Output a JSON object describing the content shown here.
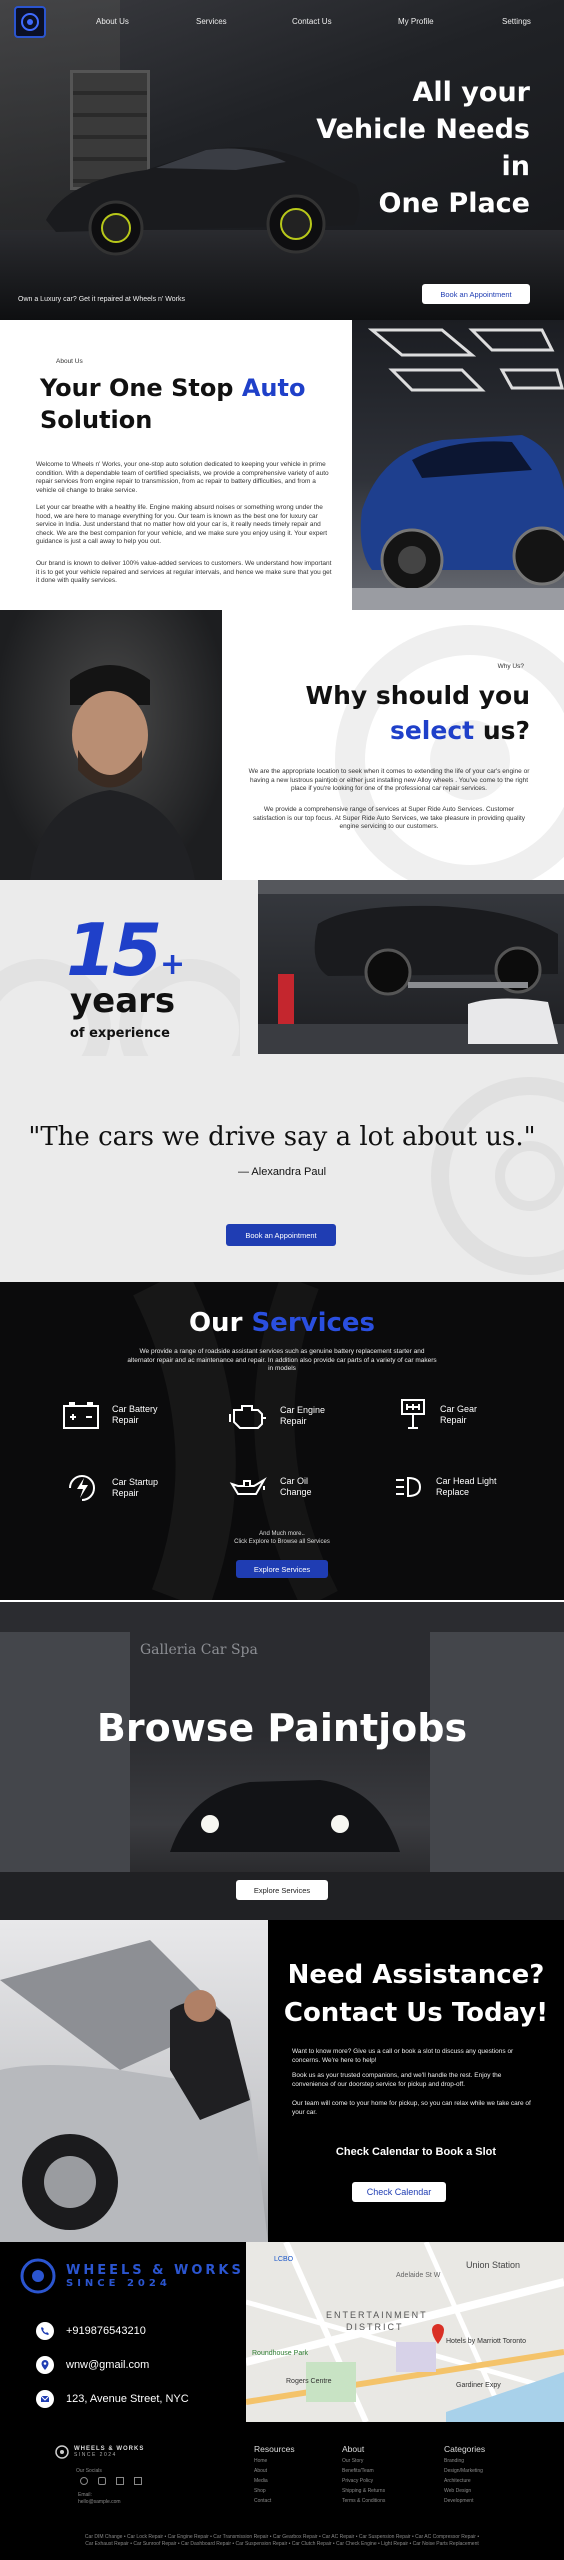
{
  "nav": {
    "logo_text": "W&W",
    "links": [
      "About Us",
      "Services",
      "Contact Us",
      "My Profile",
      "Settings"
    ]
  },
  "hero": {
    "heading_lines": [
      "All your",
      "Vehicle Needs",
      "in",
      "One Place"
    ],
    "tagline": "Own a Luxury car? Get it repaired at Wheels n' Works",
    "cta": "Book an Appointment"
  },
  "about": {
    "eyebrow": "About Us",
    "heading_a": "Your One Stop ",
    "heading_b": "Auto",
    "heading_c": "Solution",
    "p1": "Welcome to Wheels n' Works, your one-stop auto solution dedicated to keeping your vehicle in prime condition. With a dependable team of certified specialists, we provide a comprehensive variety of auto repair services from engine repair to transmission, from ac repair to battery difficulties, and from a vehicle oil change to brake service.",
    "p2": "Let your car breathe with a healthy life. Engine making absurd noises or something wrong under the hood, we are here to manage everything for you. Our team is known as the best one for luxury car service in India. Just understand that no matter how old your car is, it really needs timely repair and check. We are the best companion for your vehicle, and we make sure you enjoy using it. Your expert guidance is just a call away to help you out.",
    "p3": "Our brand is known to deliver 100% value-added services to customers. We understand how important it is to get your vehicle repaired and services at regular intervals, and hence we make sure that you get it done with quality services."
  },
  "why": {
    "eyebrow": "Why Us?",
    "heading_a": "Why should you",
    "heading_b": "select",
    "heading_c": " us?",
    "p1": "We are the appropriate location to seek when it comes to extending the life of your car's engine or having a new lustrous paintjob or either just installing new Alloy wheels . You've come to the right place if you're looking for one of the professional car repair services.",
    "p2": "We provide a comprehensive range of services at Super Ride Auto Services. Customer satisfaction is our top focus. At Super Ride Auto Services, we take pleasure in providing quality engine servicing to our customers."
  },
  "years": {
    "number": "15",
    "plus": "+",
    "word": "years",
    "sub": "of experience"
  },
  "quote": {
    "text": "\"The cars we drive say a lot about us.\"",
    "author": "— Alexandra Paul",
    "cta": "Book an Appointment"
  },
  "services": {
    "heading_a": "Our ",
    "heading_b": "Services",
    "intro": "We provide a range of roadside assistant services such as genuine battery replacement starter and alternator repair and ac maintenance and repair. In addition also provide car parts of a variety of car makers in models",
    "items": [
      {
        "l1": "Car Battery",
        "l2": "Repair",
        "icon": "battery-icon"
      },
      {
        "l1": "Car Engine",
        "l2": "Repair",
        "icon": "engine-icon"
      },
      {
        "l1": "Car Gear",
        "l2": "Repair",
        "icon": "gear-shift-icon"
      },
      {
        "l1": "Car Startup",
        "l2": "Repair",
        "icon": "startup-icon"
      },
      {
        "l1": "Car Oil",
        "l2": "Change",
        "icon": "oil-can-icon"
      },
      {
        "l1": "Car Head Light",
        "l2": "Replace",
        "icon": "headlight-icon"
      }
    ],
    "more_1": "And Much more..",
    "more_2": "Click Explore to Browse all Services",
    "cta": "Explore Services"
  },
  "paint": {
    "heading": "Browse Paintjobs",
    "sign": "Galleria Car Spa",
    "cta": "Explore Services"
  },
  "contact": {
    "h1": "Need Assistance?",
    "h2": "Contact Us Today!",
    "p1": "Want to know more? Give us a call or book a slot to discuss any questions or concerns. We're here to help!",
    "p2": "Book us as your trusted companions, and we'll handle the rest. Enjoy the convenience of our doorstep service for pickup and drop-off.",
    "p3": "Our team will come to your home for pickup, so you can relax while we take care of your car.",
    "cal_heading": "Check Calendar to Book a Slot",
    "cta": "Check Calendar"
  },
  "contact_info": {
    "brand": "WHEELS & WORKS",
    "since": "SINCE 2024",
    "phone": "+919876543210",
    "email": "wnw@gmail.com",
    "address": "123, Avenue Street, NYC"
  },
  "map": {
    "labels": [
      "LCBO",
      "Union Station",
      "ENTERTAINMENT",
      "DISTRICT",
      "Hotels by Marriott Toronto",
      "Roundhouse Park",
      "Rogers Centre",
      "Gardiner Expy",
      "Adelaide St W"
    ]
  },
  "footer": {
    "brand": "WHEELS & WORKS",
    "since": "SINCE 2024",
    "follow": "Our Socials",
    "email_label": "Email:",
    "email_value": "hello@sample.com",
    "cols": [
      {
        "title": "Resources",
        "links": [
          "Home",
          "About",
          "Media",
          "Shop",
          "Contact"
        ]
      },
      {
        "title": "About",
        "links": [
          "Our Story",
          "Benefits/Team",
          "Privacy Policy",
          "Shipping & Returns",
          "Terms & Conditions"
        ]
      },
      {
        "title": "Categories",
        "links": [
          "Branding",
          "Design/Marketing",
          "Architecture",
          "Web Design",
          "Development"
        ]
      }
    ],
    "bottom_1": "Car DIM Change • Car Lock Repair • Car Engine Repair • Car Transmission Repair • Car Gearbox Repair • Car AC Repair • Car Suspension Repair • Car AC Compressor Repair •",
    "bottom_2": "Car Exhaust Repair • Car Sunroof Repair • Car Dashboard Repair • Car Suspension Repair • Car Clutch Repair • Car Check Engine • Light Repair • Car Noise Parts Replacement"
  },
  "colors": {
    "accent": "#1f40c9",
    "button_blue": "#1f3db3",
    "dark": "#0b0b0c"
  }
}
